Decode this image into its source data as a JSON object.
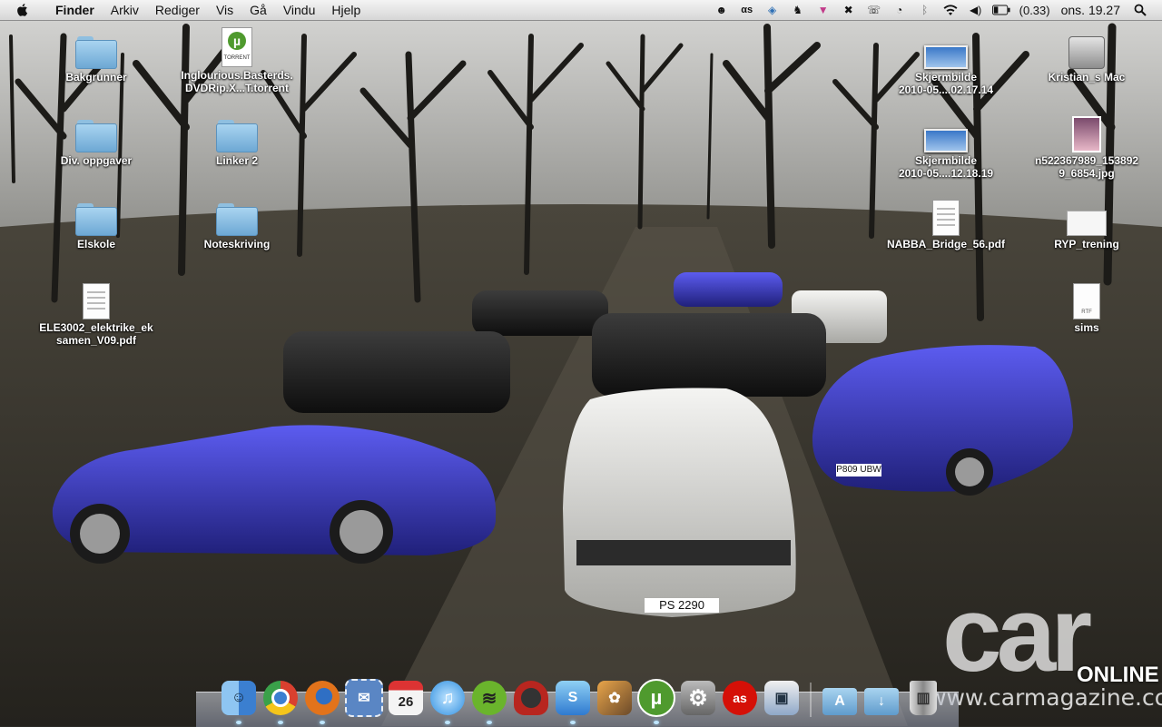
{
  "menubar": {
    "app_name": "Finder",
    "menus": [
      "Arkiv",
      "Rediger",
      "Vis",
      "Gå",
      "Vindu",
      "Hjelp"
    ],
    "battery_text": "(0.33)",
    "clock": "ons. 19.27",
    "extras": [
      "monkey-icon",
      "lastfm-icon",
      "dropbox-icon",
      "evernote-icon",
      "vpn-icon",
      "growl-icon",
      "phone-icon",
      "time-machine-icon",
      "bluetooth-icon",
      "wifi-icon",
      "volume-icon",
      "battery-icon",
      "spotlight-icon"
    ]
  },
  "desktop": {
    "left_icons": [
      {
        "label": "Bakgrunner",
        "type": "folder"
      },
      {
        "label": "Inglourious.Basterds.\nDVDRip.X...T.torrent",
        "type": "torrent"
      },
      {
        "label": "Div. oppgaver",
        "type": "folder"
      },
      {
        "label": "Linker 2",
        "type": "folder"
      },
      {
        "label": "Elskole",
        "type": "folder"
      },
      {
        "label": "Noteskriving",
        "type": "folder"
      },
      {
        "label": "ELE3002_elektrike_ek\nsamen_V09.pdf",
        "type": "pdf"
      }
    ],
    "right_icons": [
      {
        "label": "Skjermbilde\n2010-05....02.17.14",
        "type": "screenshot"
      },
      {
        "label": "Kristian_s Mac",
        "type": "hard-drive"
      },
      {
        "label": "Skjermbilde\n2010-05....12.18.19",
        "type": "screenshot"
      },
      {
        "label": "n522367989_153892\n9_6854.jpg",
        "type": "photo"
      },
      {
        "label": "NABBA_Bridge_56.pdf",
        "type": "pdf"
      },
      {
        "label": "RYP_trening",
        "type": "document"
      },
      {
        "label": "sims",
        "type": "rtf"
      }
    ]
  },
  "wallpaper": {
    "brand": "car",
    "brand_suffix": "ONLINE",
    "url": "www.carmagazine.co.uk",
    "plates": [
      "PS 2290",
      "P809 UBW"
    ]
  },
  "dock": {
    "apps": [
      {
        "name": "finder",
        "glyph": "☺",
        "color": "#4b8fdc",
        "running": true
      },
      {
        "name": "chrome",
        "glyph": "●",
        "color": "#d9402f",
        "running": true
      },
      {
        "name": "firefox",
        "glyph": "◉",
        "color": "#e2731b",
        "running": true
      },
      {
        "name": "mail",
        "glyph": "✉",
        "color": "#5a86c4",
        "running": false
      },
      {
        "name": "ical",
        "glyph": "26",
        "color": "#e8e8e8",
        "running": false
      },
      {
        "name": "itunes",
        "glyph": "♫",
        "color": "#3aa7e6",
        "running": true
      },
      {
        "name": "spotify",
        "glyph": "≋",
        "color": "#6ab42c",
        "running": true
      },
      {
        "name": "adium",
        "glyph": "◆",
        "color": "#b8261f",
        "running": false
      },
      {
        "name": "skype",
        "glyph": "S",
        "color": "#2f7ad0",
        "running": true
      },
      {
        "name": "iphoto",
        "glyph": "✿",
        "color": "#c67b2a",
        "running": false
      },
      {
        "name": "utorrent",
        "glyph": "µ",
        "color": "#4f9a2e",
        "running": true
      },
      {
        "name": "system-preferences",
        "glyph": "⚙",
        "color": "#7c7c7c",
        "running": false
      },
      {
        "name": "lastfm",
        "glyph": "as",
        "color": "#d51007",
        "running": false
      },
      {
        "name": "preview",
        "glyph": "▣",
        "color": "#8fa8c8",
        "running": false
      }
    ],
    "stacks": [
      "applications-stack-icon",
      "downloads-stack-icon",
      "trash-icon"
    ]
  }
}
